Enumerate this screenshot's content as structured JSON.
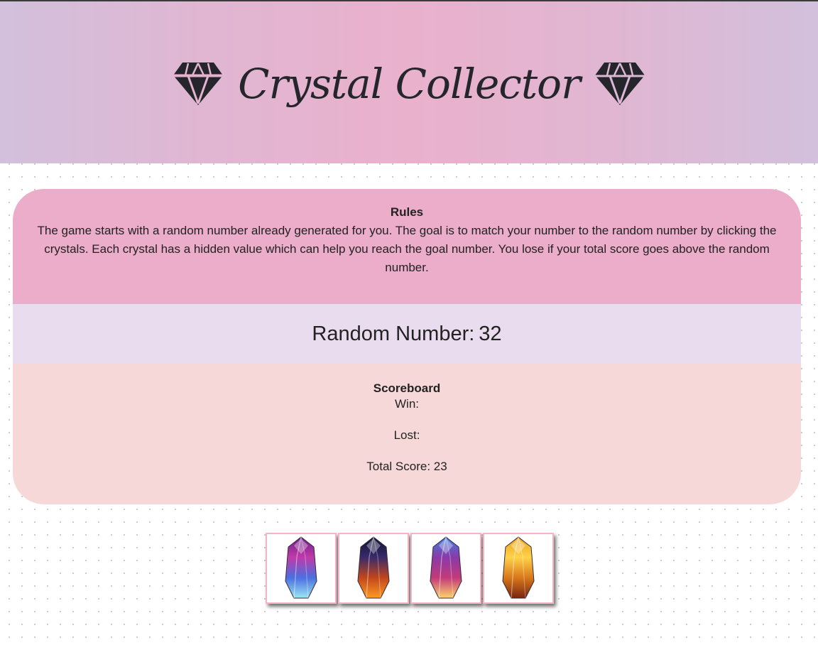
{
  "header": {
    "title": "Crystal Collector",
    "left_icon": "diamond-icon",
    "right_icon": "diamond-icon"
  },
  "rules": {
    "title": "Rules",
    "text": "The game starts with a random number already generated for you. The goal is to match your number to the random number by clicking the crystals. Each crystal has a hidden value which can help you reach the goal number. You lose if your total score goes above the random number."
  },
  "random": {
    "label": "Random Number:",
    "value": "32"
  },
  "scoreboard": {
    "title": "Scoreboard",
    "win_label": "Win:",
    "win_value": "",
    "lost_label": "Lost:",
    "lost_value": "",
    "total_label": "Total Score:",
    "total_value": "23"
  },
  "crystals": [
    {
      "name": "purple-blue-crystal",
      "colors": [
        "#6b1f8a",
        "#c03aa8",
        "#4a6fe0",
        "#9be6f2"
      ]
    },
    {
      "name": "dark-orange-crystal",
      "colors": [
        "#0c1230",
        "#3a2a6a",
        "#c2461b",
        "#ff9a22"
      ]
    },
    {
      "name": "blue-magenta-crystal",
      "colors": [
        "#3f7fe0",
        "#8a3aa8",
        "#c23a7a",
        "#ffd36a"
      ]
    },
    {
      "name": "gold-crystal",
      "colors": [
        "#e9a21e",
        "#ffd24a",
        "#d8781a",
        "#7a2410"
      ]
    }
  ],
  "colors": {
    "rules_bg": "#ecadca",
    "random_bg": "#eadcef",
    "scoreboard_bg": "#f7d8d9",
    "crystal_border": "#f4b4c4"
  }
}
